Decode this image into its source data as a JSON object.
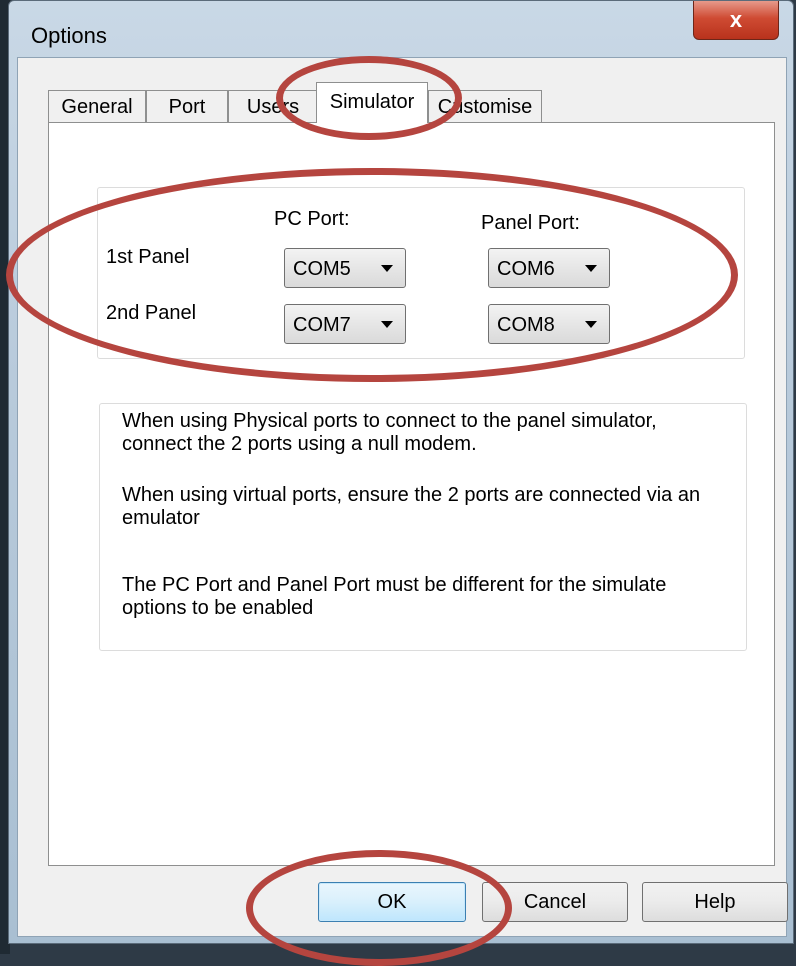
{
  "window": {
    "title": "Options",
    "close_glyph": "x"
  },
  "tabs": [
    {
      "label": "General"
    },
    {
      "label": "Port"
    },
    {
      "label": "Users"
    },
    {
      "label": "Simulator"
    },
    {
      "label": "Customise"
    }
  ],
  "active_tab": "Simulator",
  "ports": {
    "pc_port_header": "PC Port:",
    "panel_port_header": "Panel Port:",
    "rows": [
      {
        "label": "1st Panel",
        "pc_port": "COM5",
        "panel_port": "COM6"
      },
      {
        "label": "2nd Panel",
        "pc_port": "COM7",
        "panel_port": "COM8"
      }
    ]
  },
  "info": {
    "p1": "When using Physical ports to connect to the panel simulator, connect the 2 ports using a null modem.",
    "p2": "When using virtual ports, ensure the 2 ports are connected via an emulator",
    "p3": "The PC Port and Panel Port must be different for the simulate options to be enabled"
  },
  "buttons": {
    "ok": "OK",
    "cancel": "Cancel",
    "help": "Help"
  },
  "annotation_color": "#b5453f"
}
